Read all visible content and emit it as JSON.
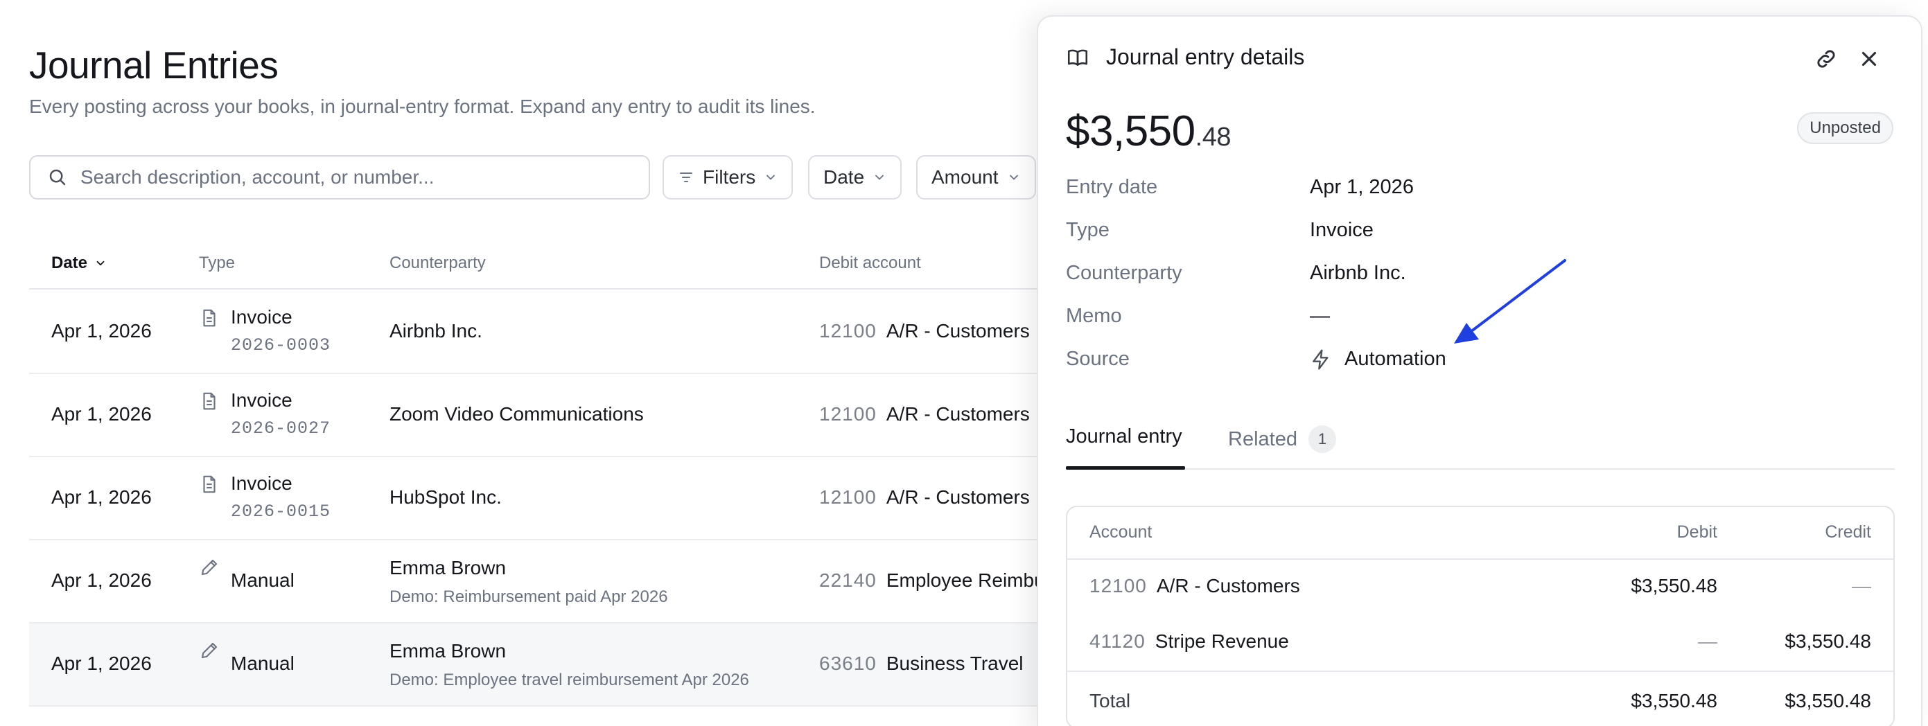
{
  "page": {
    "title": "Journal Entries",
    "subtitle": "Every posting across your books, in journal-entry format. Expand any entry to audit its lines."
  },
  "toolbar": {
    "search_placeholder": "Search description, account, or number...",
    "filters_label": "Filters",
    "date_label": "Date",
    "amount_label": "Amount"
  },
  "table": {
    "headers": {
      "date": "Date",
      "type": "Type",
      "counterparty": "Counterparty",
      "debit_account": "Debit account"
    },
    "rows": [
      {
        "date": "Apr 1, 2026",
        "type": "Invoice",
        "type_icon": "document-icon",
        "number": "2026-0003",
        "counterparty": "Airbnb Inc.",
        "memo": "",
        "debit_num": "12100",
        "debit_name": "A/R - Customers"
      },
      {
        "date": "Apr 1, 2026",
        "type": "Invoice",
        "type_icon": "document-icon",
        "number": "2026-0027",
        "counterparty": "Zoom Video Communications",
        "memo": "",
        "debit_num": "12100",
        "debit_name": "A/R - Customers"
      },
      {
        "date": "Apr 1, 2026",
        "type": "Invoice",
        "type_icon": "document-icon",
        "number": "2026-0015",
        "counterparty": "HubSpot Inc.",
        "memo": "",
        "debit_num": "12100",
        "debit_name": "A/R - Customers"
      },
      {
        "date": "Apr 1, 2026",
        "type": "Manual",
        "type_icon": "pencil-icon",
        "number": "",
        "counterparty": "Emma Brown",
        "memo": "Demo: Reimbursement paid Apr 2026",
        "debit_num": "22140",
        "debit_name": "Employee Reimbu"
      },
      {
        "date": "Apr 1, 2026",
        "type": "Manual",
        "type_icon": "pencil-icon",
        "number": "",
        "counterparty": "Emma Brown",
        "memo": "Demo: Employee travel reimbursement Apr 2026",
        "debit_num": "63610",
        "debit_name": "Business Travel"
      }
    ]
  },
  "drawer": {
    "title": "Journal entry details",
    "amount_main": "$3,550",
    "amount_cents": ".48",
    "status": "Unposted",
    "fields": {
      "entry_date_label": "Entry date",
      "entry_date": "Apr 1, 2026",
      "type_label": "Type",
      "type": "Invoice",
      "counterparty_label": "Counterparty",
      "counterparty": "Airbnb Inc.",
      "memo_label": "Memo",
      "memo": "—",
      "source_label": "Source",
      "source": "Automation"
    },
    "tabs": {
      "journal_entry": "Journal entry",
      "related": "Related",
      "related_count": "1"
    },
    "lines": {
      "headers": {
        "account": "Account",
        "debit": "Debit",
        "credit": "Credit"
      },
      "rows": [
        {
          "num": "12100",
          "name": "A/R - Customers",
          "debit": "$3,550.48",
          "credit": "—"
        },
        {
          "num": "41120",
          "name": "Stripe Revenue",
          "debit": "—",
          "credit": "$3,550.48"
        }
      ],
      "total_label": "Total",
      "total_debit": "$3,550.48",
      "total_credit": "$3,550.48"
    }
  },
  "colors": {
    "annotation_arrow": "#1f3fe0",
    "text_primary": "#15171c",
    "text_muted": "#6b7280"
  }
}
